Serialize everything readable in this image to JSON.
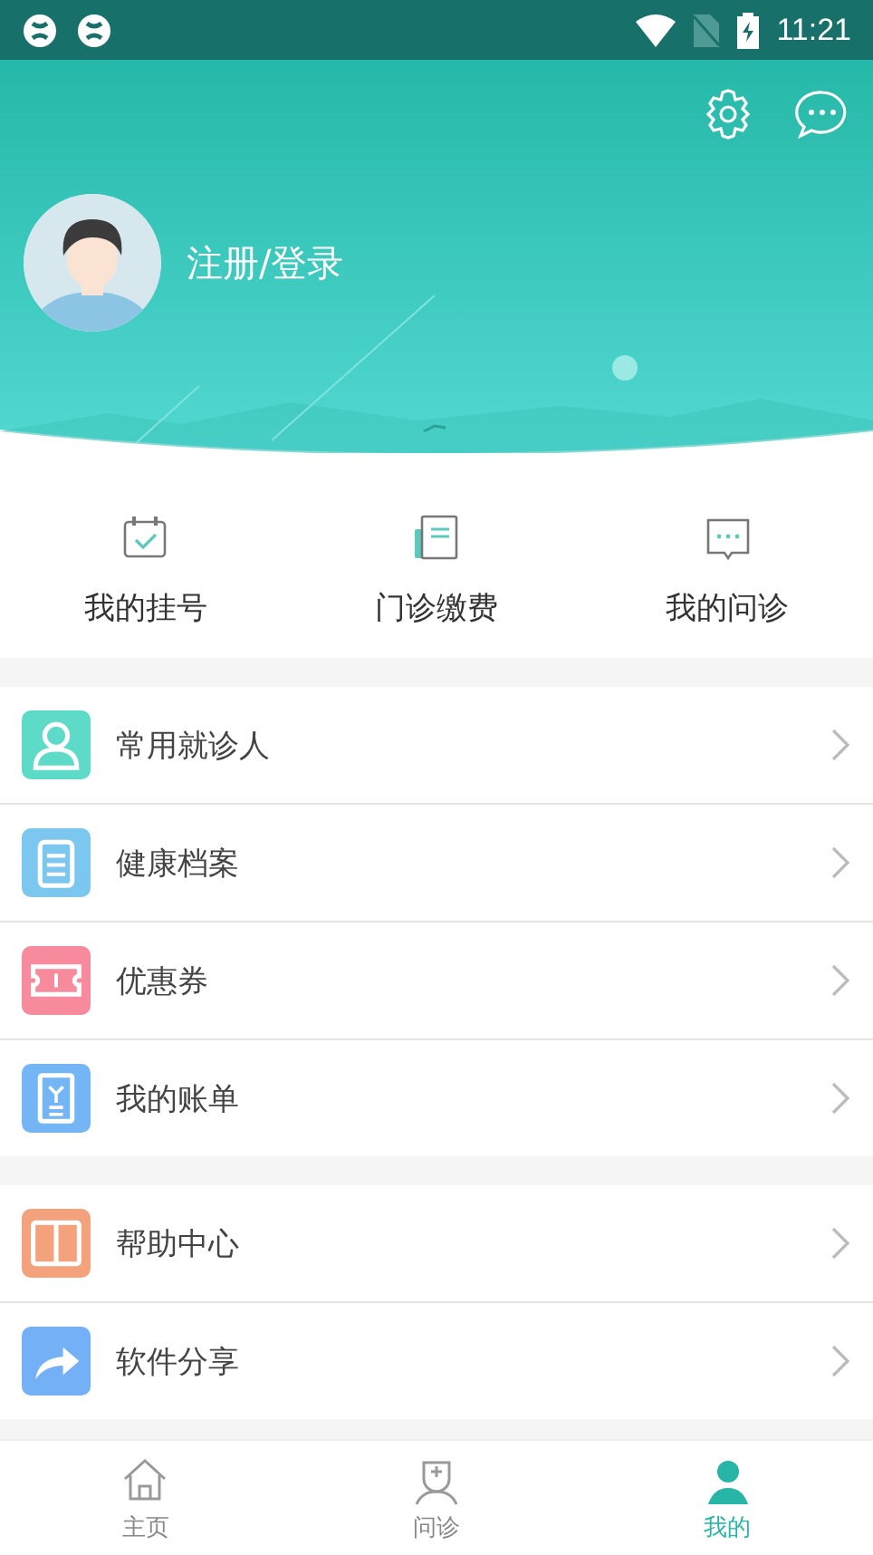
{
  "status_bar": {
    "time": "11:21"
  },
  "profile": {
    "login_label": "注册/登录"
  },
  "quick_actions": [
    {
      "label": "我的挂号"
    },
    {
      "label": "门诊缴费"
    },
    {
      "label": "我的问诊"
    }
  ],
  "menu_sections": [
    {
      "items": [
        {
          "label": "常用就诊人",
          "color": "#5ddbc8"
        },
        {
          "label": "健康档案",
          "color": "#7cc7ef"
        },
        {
          "label": "优惠券",
          "color": "#f78a9c"
        },
        {
          "label": "我的账单",
          "color": "#74b5f5"
        }
      ]
    },
    {
      "items": [
        {
          "label": "帮助中心",
          "color": "#f4a27c"
        },
        {
          "label": "软件分享",
          "color": "#74b0f5"
        }
      ]
    }
  ],
  "bottom_nav": [
    {
      "label": "主页",
      "selected": false
    },
    {
      "label": "问诊",
      "selected": false
    },
    {
      "label": "我的",
      "selected": true
    }
  ]
}
